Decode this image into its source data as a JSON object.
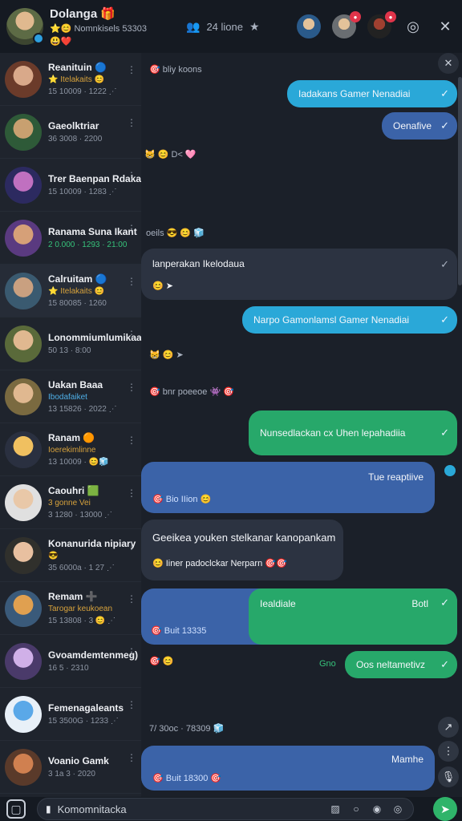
{
  "header": {
    "name": "Dolanga 🎁",
    "subtitle": "⭐😊 Nomnkisels 53303",
    "sub2": "😃❤️",
    "status_text": "24 lione",
    "close_icon": "close-icon"
  },
  "contacts": [
    {
      "name": "Reanituin 🔵",
      "sub": "⭐ Itelakaits 😊",
      "meta": "15 10009 · 1222 ⋰",
      "sub_color": "gold"
    },
    {
      "name": "Gaeolktriar",
      "sub": "",
      "meta": "36 3008 · 2200",
      "sub_color": "gold"
    },
    {
      "name": "Trer Baenpan Rdaka",
      "sub": "",
      "meta": "15 10009 · 1283 ⋰",
      "sub_color": "gold"
    },
    {
      "name": "Ranama Suna Ikant",
      "sub": "",
      "meta": "2 0.000 · 1293 · 21:00",
      "sub_color": "green"
    },
    {
      "name": "Calruitam 🔵",
      "sub": "⭐ Itelakaits 😊",
      "meta": "15 80085 · 1260",
      "sub_color": "gold"
    },
    {
      "name": "Lonommiumlumikaa)",
      "sub": "",
      "meta": "50 13 · 8:00",
      "sub_color": "gold"
    },
    {
      "name": "Uakan Baaa",
      "sub": "Ibodafaiket",
      "meta": "13 15826 · 2022 ⋰",
      "sub_color": "blue"
    },
    {
      "name": "Ranam 🟠",
      "sub": "Ioerekimlinne",
      "meta": "13 10009 · 😊🧊",
      "sub_color": "gold"
    },
    {
      "name": "Caouhri 🟩",
      "sub": "3 gonne Vei",
      "meta": "3 1280 · 13000 ⋰",
      "sub_color": "gold"
    },
    {
      "name": "Konanurida nipiary",
      "sub": "😎",
      "meta": "35 6000a · 1 27 ⋰",
      "sub_color": "gold"
    },
    {
      "name": "Remam ➕",
      "sub": "Tarogar keukoean",
      "meta": "15 13808 · 3 😊 ⋰",
      "sub_color": "gold"
    },
    {
      "name": "Gvoamdemtenmeg)",
      "sub": "",
      "meta": "16 5 · 2310",
      "sub_color": "gold"
    },
    {
      "name": "Femenagaleants",
      "sub": "",
      "meta": "15 3500G · 1233 ⋰",
      "sub_color": "gold"
    },
    {
      "name": "Voanio Gamk",
      "sub": "",
      "meta": "3 1a 3 · 2020",
      "sub_color": "gold"
    }
  ],
  "messages": [
    {
      "kind": "in-meta",
      "text": "🎯 bliy koons"
    },
    {
      "kind": "out",
      "text": "Iadakans Gamer Nenadiai",
      "color": "cyan"
    },
    {
      "kind": "out",
      "text": "Oenafive",
      "color": "blue"
    },
    {
      "kind": "in-meta",
      "text": "😸 😊 D< 🩷"
    },
    {
      "kind": "in-meta",
      "text": "oeils 😎 😊 🧊"
    },
    {
      "kind": "in",
      "text": "lanperakan Ikelodaua",
      "sub": "😊 ➤"
    },
    {
      "kind": "out",
      "text": "Narpo Gamonlamsl Gamer Nenadiai",
      "color": "cyan"
    },
    {
      "kind": "in-meta",
      "text": "😸 😊 ➤"
    },
    {
      "kind": "in-meta",
      "text": "🎯 bnr poeeoe 👾 🎯"
    },
    {
      "kind": "out",
      "text": "Nunsedlackan cx Uhen lepahadiia",
      "color": "green"
    },
    {
      "kind": "in-wide",
      "text": "Tue reaptiive",
      "sub": "🎯 Bio IIion 😊"
    },
    {
      "kind": "in",
      "text": "Geeikea youken stelkanar kanopankam",
      "sub": "😊 Iiner padoclckar Nerparn 🎯🎯"
    },
    {
      "kind": "out-wide",
      "text": "Iealdiale",
      "right": "Botl",
      "sub": "🎯 Buit 13335",
      "color": "green"
    },
    {
      "kind": "out",
      "text": "Oos neltametivz",
      "pre": "Gno",
      "color": "green"
    },
    {
      "kind": "in-meta",
      "text": "🎯 😊"
    },
    {
      "kind": "in-meta",
      "text": "7/ 30oc · 78309 🧊"
    },
    {
      "kind": "in-wide",
      "text": "Mamhe",
      "sub": "🎯 Buit 18300 🎯"
    }
  ],
  "composer": {
    "placeholder": "Komomnitacka",
    "value": "Komomnitacka"
  },
  "colors": {
    "cyan": "#2aa8d8",
    "blue": "#3b63a8",
    "green": "#27a86a",
    "dark_bubble": "#2c3341",
    "background": "#1b2029"
  }
}
